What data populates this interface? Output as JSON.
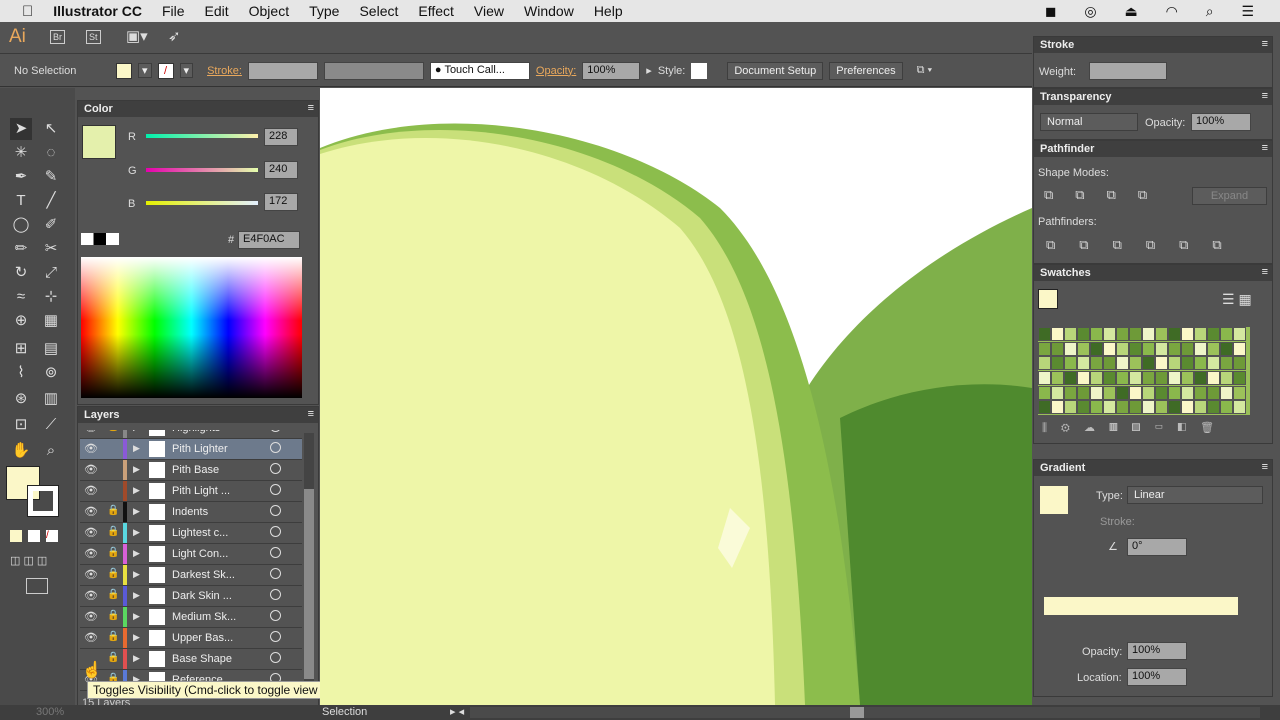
{
  "menubar": {
    "app": "Illustrator CC",
    "items": [
      "File",
      "Edit",
      "Object",
      "Type",
      "Select",
      "Effect",
      "View",
      "Window",
      "Help"
    ]
  },
  "appbar": {
    "logo": "Ai",
    "br": "Br",
    "st": "St"
  },
  "control": {
    "selection": "No Selection",
    "stroke_label": "Stroke:",
    "brush": "Touch Call...",
    "opacity_label": "Opacity:",
    "opacity": "100%",
    "style_label": "Style:",
    "doc_setup": "Document Setup",
    "preferences": "Preferences",
    "fill_color": "#fbf7c8"
  },
  "color": {
    "title": "Color",
    "r": "228",
    "g": "240",
    "b": "172",
    "r_label": "R",
    "g_label": "G",
    "b_label": "B",
    "hex_label": "#",
    "hex": "E4F0AC",
    "swatch": "#e4f0ac"
  },
  "layers": {
    "title": "Layers",
    "count": "15 Layers",
    "rows": [
      {
        "name": "Highlights",
        "color": "#888888",
        "lock": true
      },
      {
        "name": "Pith Lighter",
        "color": "#8a5ad8",
        "lock": false,
        "selected": true
      },
      {
        "name": "Pith Base",
        "color": "#c9a07a",
        "lock": false
      },
      {
        "name": "Pith Light ...",
        "color": "#a04a2a",
        "lock": false
      },
      {
        "name": "Indents",
        "color": "#111111",
        "lock": true
      },
      {
        "name": "Lightest c...",
        "color": "#5ad8e0",
        "lock": true
      },
      {
        "name": "Light Con...",
        "color": "#d860d8",
        "lock": true
      },
      {
        "name": "Darkest Sk...",
        "color": "#e8e040",
        "lock": true
      },
      {
        "name": "Dark Skin ...",
        "color": "#5a5ad8",
        "lock": true
      },
      {
        "name": "Medium Sk...",
        "color": "#5ad860",
        "lock": true
      },
      {
        "name": "Upper Bas...",
        "color": "#e86a30",
        "lock": true
      },
      {
        "name": "Base Shape",
        "color": "#e05050",
        "lock": true,
        "hidden": true
      },
      {
        "name": "Reference",
        "color": "#5a7ad8",
        "lock": true
      }
    ],
    "tooltip": "Toggles Visibility (Cmd-click to toggle view mode)"
  },
  "stroke": {
    "title": "Stroke",
    "weight_label": "Weight:"
  },
  "transparency": {
    "title": "Transparency",
    "mode": "Normal",
    "opacity_label": "Opacity:",
    "opacity": "100%"
  },
  "pathfinder": {
    "title": "Pathfinder",
    "shape_modes": "Shape Modes:",
    "pathfinders": "Pathfinders:",
    "expand": "Expand"
  },
  "swatches": {
    "title": "Swatches"
  },
  "gradient": {
    "title": "Gradient",
    "type_label": "Type:",
    "type": "Linear",
    "stroke_label": "Stroke:",
    "angle": "0°",
    "opacity_label": "Opacity:",
    "opacity": "100%",
    "location_label": "Location:",
    "location": "100%",
    "ramp_color": "#fbf7c8"
  },
  "status": {
    "zoom": "300%",
    "tool": "Selection"
  }
}
